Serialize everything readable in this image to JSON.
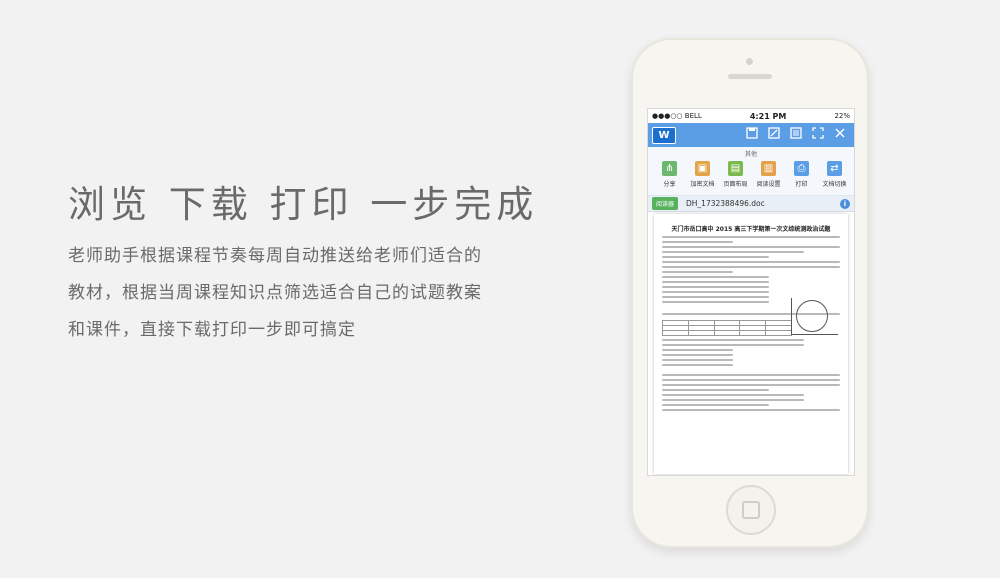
{
  "headline": "浏览 下载 打印 一步完成",
  "description": [
    "老师助手根据课程节奏每周自动推送给老师们适合的",
    "教材，根据当周课程知识点筛选适合自己的试题教案",
    "和课件，直接下载打印一步即可搞定"
  ],
  "phone": {
    "status": {
      "carrier": "●●●○○ BELL",
      "time": "4:21 PM",
      "battery": "22%"
    },
    "toolbar": {
      "logo": "W",
      "icons": [
        "save-icon",
        "edit-icon",
        "list-icon",
        "expand-icon",
        "close-icon"
      ]
    },
    "menu": {
      "title": "其他",
      "items": [
        {
          "label": "分享",
          "icon": "share-icon",
          "color": "#6cb86f"
        },
        {
          "label": "加密文档",
          "icon": "lock-doc-icon",
          "color": "#e2a64a"
        },
        {
          "label": "页面布局",
          "icon": "layout-icon",
          "color": "#7cba4e"
        },
        {
          "label": "阅读设置",
          "icon": "reading-settings-icon",
          "color": "#e6a24a"
        },
        {
          "label": "打印",
          "icon": "print-icon",
          "color": "#5b9ee6"
        },
        {
          "label": "文档切换",
          "icon": "switch-doc-icon",
          "color": "#5b9ee6"
        }
      ]
    },
    "filebar": {
      "reader": "阅读器",
      "filename": "DH_1732388496.doc",
      "info": "i"
    },
    "document": {
      "title": "天门市岳口高中 2015 高三下学期第一次文综统测政治试题"
    }
  }
}
